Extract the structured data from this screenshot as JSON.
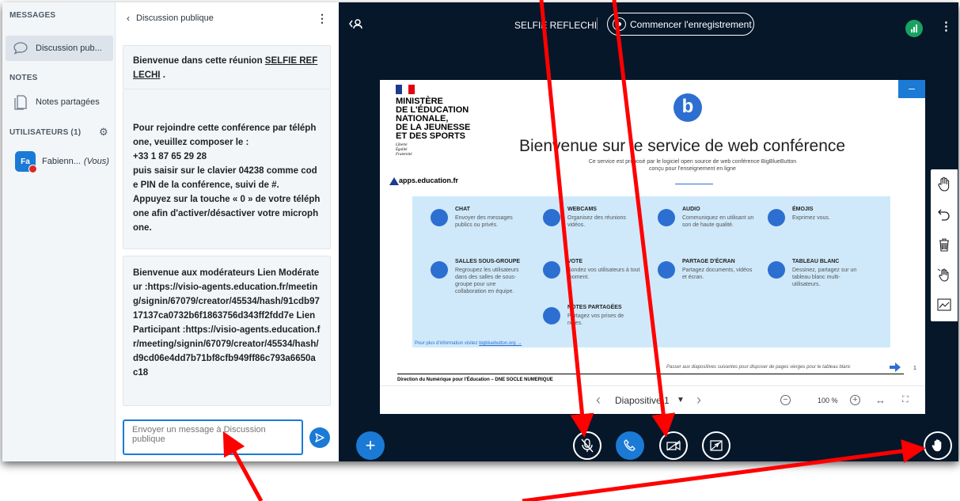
{
  "nav": {
    "messages_heading": "MESSAGES",
    "public_chat_label": "Discussion pub...",
    "notes_heading": "NOTES",
    "shared_notes_label": "Notes partagées",
    "users_heading": "UTILISATEURS (1)",
    "user_initials": "Fa",
    "user_name": "Fabienn...",
    "user_you": "(Vous)"
  },
  "chat": {
    "back_title": "Discussion publique",
    "welcome_prefix": "Bienvenue dans cette réunion ",
    "meeting_name": "SELFIE REFLECHI",
    "welcome_suffix": " .",
    "phone_text": "Pour rejoindre cette conférence par téléphone, veuillez composer le :\n+33 1 87 65 29 28\npuis saisir sur le clavier 04238 comme code PIN de la conférence, suivi de #.\nAppuyez sur la touche « 0 » de votre téléphone afin d'activer/désactiver votre microphone.",
    "moderator_text": "Bienvenue aux modérateurs Lien Modérateur :https://visio-agents.education.fr/meeting/signin/67079/creator/45534/hash/91cdb9717137ca0732b6f1863756d343ff2fdd7e Lien Participant :https://visio-agents.education.fr/meeting/signin/67079/creator/45534/hash/d9cd06e4dd7b71bf8cfb949ff86c793a6650ac18",
    "input_placeholder": "Envoyer un message à Discussion publique"
  },
  "topbar": {
    "meeting_title": "SELFIE REFLECHI",
    "record_label": "Commencer l'enregistrement"
  },
  "slide": {
    "ministry": "MINISTÈRE\nDE L'ÉDUCATION\nNATIONALE,\nDE LA JEUNESSE\nET DES SPORTS",
    "motto": "Liberté\nÉgalité\nFraternité",
    "apps": "apps.education.fr",
    "headline": "Bienvenue sur le service de web conférence",
    "subline": "Ce service est proposé par le logiciel open source de web conférence BigBlueButton\nconçu pour l'enseignement en ligne",
    "tiles": [
      {
        "title": "CHAT",
        "desc": "Envoyer des messages publics ou privés."
      },
      {
        "title": "WEBCAMS",
        "desc": "Organisez des réunions vidéos."
      },
      {
        "title": "AUDIO",
        "desc": "Communiquez en utilisant un son de haute qualité."
      },
      {
        "title": "ÉMOJIS",
        "desc": "Exprimez vous."
      },
      {
        "title": "SALLES SOUS-GROUPE",
        "desc": "Regroupez les utilisateurs dans des salles de sous-groupe pour une collaboration en équipe."
      },
      {
        "title": "VOTE",
        "desc": "Sondez vos utilisateurs à tout moment."
      },
      {
        "title": "PARTAGE D'ÉCRAN",
        "desc": "Partagez documents, vidéos et écran."
      },
      {
        "title": "TABLEAU BLANC",
        "desc": "Dessinez, partagez sur un tableau blanc multi-utilisateurs."
      },
      {
        "title": "NOTES PARTAGÉES",
        "desc": "Partagez vos prises de notes."
      }
    ],
    "more_info": "Pour plus d'information visitez ",
    "more_link": "bigbluebutton.org →",
    "next_hint": "Passer aux diapositives suivantes pour disposer de pages vierges pour le tableau blanc",
    "page_number": "1",
    "footer": "Direction du Numérique pour l'Éducation – DNE SOCLE NUMERIQUE"
  },
  "slide_toolbar": {
    "slide_select": "Diapositive 1",
    "zoom": "100 %"
  },
  "colors": {
    "accent": "#1b7ad6",
    "bg": "#06172a",
    "arrow": "#ff0000",
    "connection": "#18a360"
  }
}
